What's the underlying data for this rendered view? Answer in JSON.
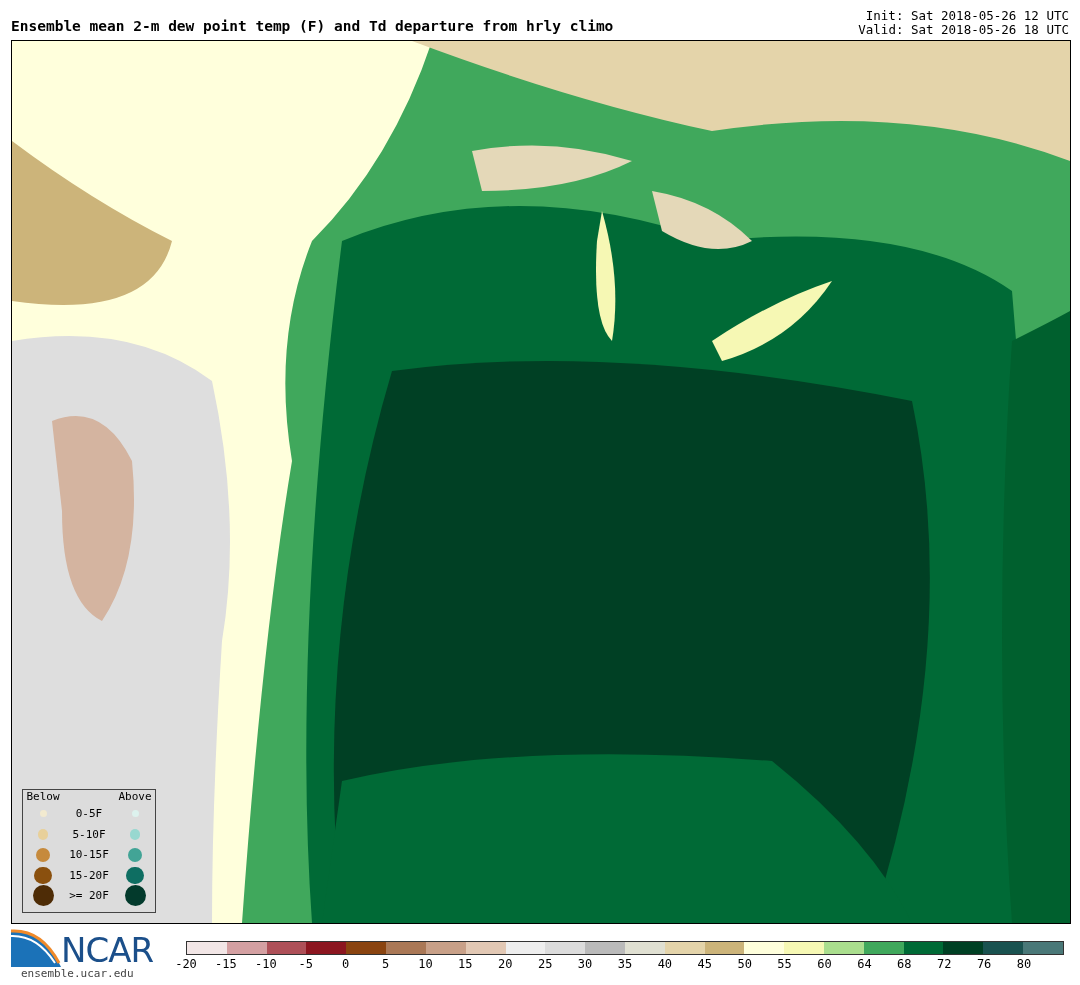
{
  "title": "Ensemble mean 2-m dew point temp (F) and Td departure from hrly climo",
  "run_info": [
    "Init: Sat 2018-05-26 12 UTC",
    "Valid: Sat 2018-05-26 18 UTC"
  ],
  "legend": {
    "below_heading": "Below",
    "above_heading": "Above",
    "rows": [
      {
        "label": "0-5F",
        "below": {
          "color": "#f2ead0"
        },
        "above": {
          "color": "#ddf2ee"
        }
      },
      {
        "label": "5-10F",
        "below": {
          "color": "#e8d09a"
        },
        "above": {
          "color": "#98d8d0"
        }
      },
      {
        "label": "10-15F",
        "below": {
          "color": "#c68a3c"
        },
        "above": {
          "color": "#42a496"
        }
      },
      {
        "label": "15-20F",
        "below": {
          "color": "#8a500e"
        },
        "above": {
          "color": "#0e6e62"
        }
      },
      {
        "label": ">= 20F",
        "below": {
          "color": "#4e2c06"
        },
        "above": {
          "color": "#033a2c"
        }
      }
    ]
  },
  "logo": {
    "text": "NCAR",
    "url": "ensemble.ucar.edu"
  },
  "colorbar": [
    {
      "label": "-20",
      "color": "#f2e6e6"
    },
    {
      "label": "-15",
      "color": "#d4a0a2"
    },
    {
      "label": "-10",
      "color": "#ae5058"
    },
    {
      "label": "-5",
      "color": "#8c1620"
    },
    {
      "label": "0",
      "color": "#8a4410"
    },
    {
      "label": "5",
      "color": "#aa7856"
    },
    {
      "label": "10",
      "color": "#c8a088"
    },
    {
      "label": "15",
      "color": "#e2c8b4"
    },
    {
      "label": "20",
      "color": "#eeeeee"
    },
    {
      "label": "25",
      "color": "#dcdcdc"
    },
    {
      "label": "30",
      "color": "#bababa"
    },
    {
      "label": "35",
      "color": "#e0e0d2"
    },
    {
      "label": "40",
      "color": "#e4d4aa"
    },
    {
      "label": "45",
      "color": "#ccb47a"
    },
    {
      "label": "50",
      "color": "#ffffdc"
    },
    {
      "label": "55",
      "color": "#f6f8b4"
    },
    {
      "label": "60",
      "color": "#aade8e"
    },
    {
      "label": "64",
      "color": "#40a85c"
    },
    {
      "label": "68",
      "color": "#006a36"
    },
    {
      "label": "72",
      "color": "#004024"
    },
    {
      "label": "76",
      "color": "#1a5250"
    },
    {
      "label": "80",
      "color": "#4a7878"
    }
  ]
}
